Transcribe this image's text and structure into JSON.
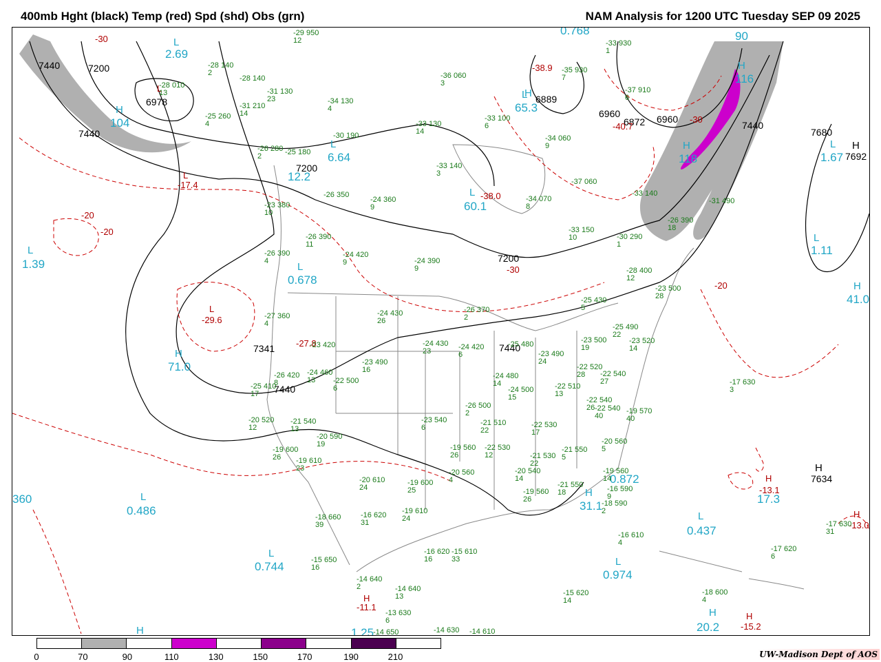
{
  "header": {
    "left_title": "400mb Hght (black) Temp (red) Spd (shd) Obs (grn)",
    "right_title": "NAM Analysis for 1200 UTC Tuesday  SEP 09 2025"
  },
  "colors": {
    "height_contour": "#000000",
    "temp_contour": "#cc0000",
    "speed_70_90": "#b0b0b0",
    "speed_110_130": "#cc00cc",
    "speed_150_170": "#8b008b",
    "speed_190_210": "#4b0050",
    "obs": "#1a7a1a",
    "cyan_labels": "#21a6c6",
    "coastline": "#888888"
  },
  "height_labels": [
    {
      "text": "7440"
    },
    {
      "text": "7200"
    },
    {
      "text": "6978"
    },
    {
      "text": "7440"
    },
    {
      "text": "7200"
    },
    {
      "text": "6889"
    },
    {
      "text": "6960"
    },
    {
      "text": "6872"
    },
    {
      "text": "6960"
    },
    {
      "text": "7440"
    },
    {
      "text": "7680"
    },
    {
      "text": "7692"
    },
    {
      "text": "7200"
    },
    {
      "text": "7341"
    },
    {
      "text": "7440"
    },
    {
      "text": "7440"
    },
    {
      "text": "7634"
    }
  ],
  "temp_extremes": [
    {
      "text": "-38.9"
    },
    {
      "text": "-40.7"
    },
    {
      "text": "-38.0"
    },
    {
      "text": "-17.4"
    },
    {
      "text": "-29.6"
    },
    {
      "text": "-27.8"
    },
    {
      "text": "-13.1"
    },
    {
      "text": "-13.0"
    },
    {
      "text": "-11.1"
    },
    {
      "text": "-15.2"
    },
    {
      "text": "-30"
    },
    {
      "text": "-20"
    },
    {
      "text": "-20"
    },
    {
      "text": "-30"
    },
    {
      "text": "-20"
    },
    {
      "text": "-30"
    }
  ],
  "cyan_labels": [
    {
      "text": "2.69"
    },
    {
      "text": "104"
    },
    {
      "text": "6.64"
    },
    {
      "text": "12.2"
    },
    {
      "text": "65.3"
    },
    {
      "text": "60.1"
    },
    {
      "text": "0.768"
    },
    {
      "text": "90"
    },
    {
      "text": "116"
    },
    {
      "text": "118"
    },
    {
      "text": "1.67"
    },
    {
      "text": "1.11"
    },
    {
      "text": "1.39"
    },
    {
      "text": "0.678"
    },
    {
      "text": "71.0"
    },
    {
      "text": "41.0"
    },
    {
      "text": "360"
    },
    {
      "text": "0.486"
    },
    {
      "text": "0.744"
    },
    {
      "text": "0.872"
    },
    {
      "text": "31.1"
    },
    {
      "text": "0.437"
    },
    {
      "text": "0.974"
    },
    {
      "text": "17.3"
    },
    {
      "text": "20.2"
    },
    {
      "text": "1.25"
    }
  ],
  "hl_markers": [
    {
      "text": "L"
    },
    {
      "text": "H"
    },
    {
      "text": "L"
    },
    {
      "text": "L"
    },
    {
      "text": "H"
    },
    {
      "text": "L"
    },
    {
      "text": "H"
    },
    {
      "text": "H"
    },
    {
      "text": "L"
    },
    {
      "text": "L"
    },
    {
      "text": "H"
    },
    {
      "text": "L"
    },
    {
      "text": "L"
    },
    {
      "text": "L"
    },
    {
      "text": "H"
    },
    {
      "text": "L"
    },
    {
      "text": "H"
    },
    {
      "text": "L"
    },
    {
      "text": "H"
    },
    {
      "text": "L"
    },
    {
      "text": "H"
    },
    {
      "text": "L"
    },
    {
      "text": "H"
    },
    {
      "text": "H"
    },
    {
      "text": "L"
    },
    {
      "text": "H"
    },
    {
      "text": "H"
    },
    {
      "text": "H"
    },
    {
      "text": "H"
    },
    {
      "text": "L"
    }
  ],
  "observations": [
    {
      "t": "-29",
      "h": "950",
      "d": "12"
    },
    {
      "t": "-28",
      "h": "140",
      "d": "2"
    },
    {
      "t": "-28",
      "h": "010",
      "d": "13"
    },
    {
      "t": "-28",
      "h": "140",
      "d": ""
    },
    {
      "t": "-31",
      "h": "130",
      "d": "23"
    },
    {
      "t": "-34",
      "h": "130",
      "d": "4"
    },
    {
      "t": "-31",
      "h": "210",
      "d": "14"
    },
    {
      "t": "-25",
      "h": "260",
      "d": "4"
    },
    {
      "t": "-36",
      "h": "060",
      "d": "3"
    },
    {
      "t": "-33",
      "h": "100",
      "d": "6"
    },
    {
      "t": "-33",
      "h": "130",
      "d": "14"
    },
    {
      "t": "-35",
      "h": "930",
      "d": "7"
    },
    {
      "t": "-33",
      "h": "930",
      "d": "1"
    },
    {
      "t": "-37",
      "h": "910",
      "d": "6"
    },
    {
      "t": "-34",
      "h": "060",
      "d": "9"
    },
    {
      "t": "-30",
      "h": "190",
      "d": ""
    },
    {
      "t": "-26",
      "h": "280",
      "d": "2"
    },
    {
      "t": "-25",
      "h": "180",
      "d": ""
    },
    {
      "t": "-33",
      "h": "140",
      "d": "3"
    },
    {
      "t": "-37",
      "h": "060",
      "d": ""
    },
    {
      "t": "-34",
      "h": "070",
      "d": "8"
    },
    {
      "t": "-33",
      "h": "140",
      "d": ""
    },
    {
      "t": "-26",
      "h": "350",
      "d": ""
    },
    {
      "t": "-24",
      "h": "360",
      "d": "9"
    },
    {
      "t": "-23",
      "h": "380",
      "d": "10"
    },
    {
      "t": "-33",
      "h": "150",
      "d": "10"
    },
    {
      "t": "-30",
      "h": "290",
      "d": "1"
    },
    {
      "t": "-31",
      "h": "490",
      "d": ""
    },
    {
      "t": "-26",
      "h": "390",
      "d": "18"
    },
    {
      "t": "-26",
      "h": "390",
      "d": "11"
    },
    {
      "t": "-26",
      "h": "390",
      "d": "4"
    },
    {
      "t": "-24",
      "h": "420",
      "d": "9"
    },
    {
      "t": "-24",
      "h": "390",
      "d": "9"
    },
    {
      "t": "-28",
      "h": "400",
      "d": "12"
    },
    {
      "t": "-23",
      "h": "500",
      "d": "28"
    },
    {
      "t": "-25",
      "h": "430",
      "d": "5"
    },
    {
      "t": "-27",
      "h": "360",
      "d": "4"
    },
    {
      "t": "-24",
      "h": "430",
      "d": "26"
    },
    {
      "t": "-26",
      "h": "370",
      "d": "2"
    },
    {
      "t": "-25",
      "h": "490",
      "d": "22"
    },
    {
      "t": "-23",
      "h": "420",
      "d": ""
    },
    {
      "t": "-23",
      "h": "490",
      "d": "16"
    },
    {
      "t": "-24",
      "h": "430",
      "d": "23"
    },
    {
      "t": "-24",
      "h": "420",
      "d": "6"
    },
    {
      "t": "-25",
      "h": "480",
      "d": ""
    },
    {
      "t": "-23",
      "h": "500",
      "d": "19"
    },
    {
      "t": "-23",
      "h": "520",
      "d": "14"
    },
    {
      "t": "-23",
      "h": "490",
      "d": "24"
    },
    {
      "t": "-26",
      "h": "420",
      "d": "8"
    },
    {
      "t": "-24",
      "h": "460",
      "d": "13"
    },
    {
      "t": "-22",
      "h": "500",
      "d": "6"
    },
    {
      "t": "-25",
      "h": "410",
      "d": "17"
    },
    {
      "t": "-24",
      "h": "480",
      "d": "14"
    },
    {
      "t": "-24",
      "h": "500",
      "d": "15"
    },
    {
      "t": "-22",
      "h": "520",
      "d": "28"
    },
    {
      "t": "-22",
      "h": "540",
      "d": "27"
    },
    {
      "t": "-17",
      "h": "630",
      "d": "3"
    },
    {
      "t": "-22",
      "h": "510",
      "d": "13"
    },
    {
      "t": "-22",
      "h": "540",
      "d": "26"
    },
    {
      "t": "-22",
      "h": "540",
      "d": "40"
    },
    {
      "t": "-19",
      "h": "570",
      "d": "40"
    },
    {
      "t": "-20",
      "h": "520",
      "d": "12"
    },
    {
      "t": "-21",
      "h": "540",
      "d": "13"
    },
    {
      "t": "-20",
      "h": "590",
      "d": "19"
    },
    {
      "t": "-23",
      "h": "540",
      "d": "6"
    },
    {
      "t": "-26",
      "h": "500",
      "d": "2"
    },
    {
      "t": "-21",
      "h": "510",
      "d": "22"
    },
    {
      "t": "-22",
      "h": "530",
      "d": "17"
    },
    {
      "t": "-19",
      "h": "600",
      "d": "26"
    },
    {
      "t": "-19",
      "h": "610",
      "d": "23"
    },
    {
      "t": "-19",
      "h": "560",
      "d": "26"
    },
    {
      "t": "-22",
      "h": "530",
      "d": "12"
    },
    {
      "t": "-21",
      "h": "530",
      "d": "22"
    },
    {
      "t": "-21",
      "h": "550",
      "d": "5"
    },
    {
      "t": "-20",
      "h": "560",
      "d": "5"
    },
    {
      "t": "-20",
      "h": "560",
      "d": "4"
    },
    {
      "t": "-20",
      "h": "610",
      "d": "24"
    },
    {
      "t": "-19",
      "h": "600",
      "d": "25"
    },
    {
      "t": "-20",
      "h": "540",
      "d": "14"
    },
    {
      "t": "-19",
      "h": "560",
      "d": "26"
    },
    {
      "t": "-21",
      "h": "550",
      "d": "18"
    },
    {
      "t": "-19",
      "h": "560",
      "d": "14"
    },
    {
      "t": "-16",
      "h": "590",
      "d": "9"
    },
    {
      "t": "-18",
      "h": "590",
      "d": "2"
    },
    {
      "t": "-18",
      "h": "660",
      "d": "39"
    },
    {
      "t": "-16",
      "h": "620",
      "d": "31"
    },
    {
      "t": "-19",
      "h": "610",
      "d": "24"
    },
    {
      "t": "-16",
      "h": "610",
      "d": "4"
    },
    {
      "t": "-15",
      "h": "650",
      "d": "16"
    },
    {
      "t": "-16",
      "h": "620",
      "d": "16"
    },
    {
      "t": "-15",
      "h": "610",
      "d": "33"
    },
    {
      "t": "-14",
      "h": "640",
      "d": "2"
    },
    {
      "t": "-14",
      "h": "640",
      "d": "13"
    },
    {
      "t": "-13",
      "h": "630",
      "d": "6"
    },
    {
      "t": "-14",
      "h": "650",
      "d": ""
    },
    {
      "t": "-14",
      "h": "630",
      "d": ""
    },
    {
      "t": "-14",
      "h": "610",
      "d": ""
    },
    {
      "t": "-15",
      "h": "620",
      "d": "14"
    },
    {
      "t": "-18",
      "h": "600",
      "d": "4"
    },
    {
      "t": "-17",
      "h": "620",
      "d": "6"
    },
    {
      "t": "-17",
      "h": "630",
      "d": "31"
    }
  ],
  "legend": {
    "ticks": [
      "0",
      "70",
      "90",
      "110",
      "130",
      "150",
      "170",
      "190",
      "210"
    ],
    "cells": [
      "#ffffff",
      "#b0b0b0",
      "#ffffff",
      "#cc00cc",
      "#ffffff",
      "#8b008b",
      "#ffffff",
      "#4b0050",
      "#ffffff"
    ]
  },
  "credit": "UW-Madison  Dept of AOS"
}
